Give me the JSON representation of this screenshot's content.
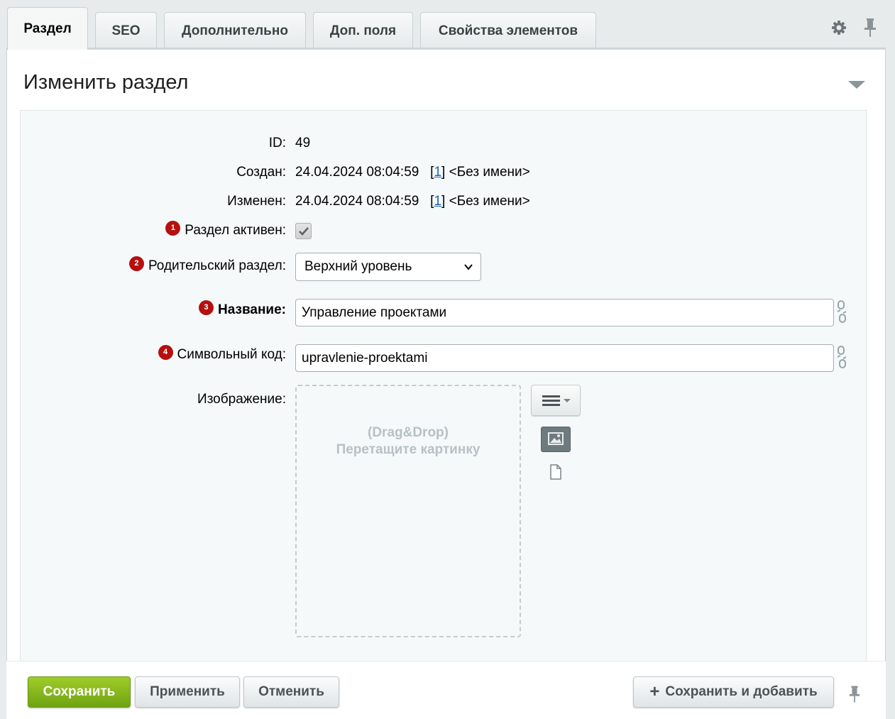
{
  "tabs": [
    {
      "label": "Раздел",
      "active": true
    },
    {
      "label": "SEO",
      "active": false
    },
    {
      "label": "Дополнительно",
      "active": false
    },
    {
      "label": "Доп. поля",
      "active": false
    },
    {
      "label": "Свойства элементов",
      "active": false
    }
  ],
  "panel": {
    "title": "Изменить раздел"
  },
  "fields": {
    "id": {
      "label": "ID:",
      "value": "49"
    },
    "created": {
      "label": "Создан:",
      "date": "24.04.2024 08:04:59",
      "user_id": "1",
      "user_name": "<Без имени>"
    },
    "modified": {
      "label": "Изменен:",
      "date": "24.04.2024 08:04:59",
      "user_id": "1",
      "user_name": "<Без имени>"
    },
    "active": {
      "badge": "1",
      "label": "Раздел активен:",
      "checked": true
    },
    "parent": {
      "badge": "2",
      "label": "Родительский раздел:",
      "value": "Верхний уровень"
    },
    "name": {
      "badge": "3",
      "label": "Название:",
      "value": "Управление проектами"
    },
    "code": {
      "badge": "4",
      "label": "Символьный код:",
      "value": "upravlenie-proektami"
    },
    "image": {
      "label": "Изображение:",
      "drop_line1": "(Drag&Drop)",
      "drop_line2": "Перетащите картинку"
    }
  },
  "footer": {
    "save": "Сохранить",
    "apply": "Применить",
    "cancel": "Отменить",
    "save_add": "Сохранить и добавить"
  },
  "colors": {
    "badge": "#b50f0f",
    "save_button": "#8dbb1f",
    "link": "#2067b0"
  }
}
